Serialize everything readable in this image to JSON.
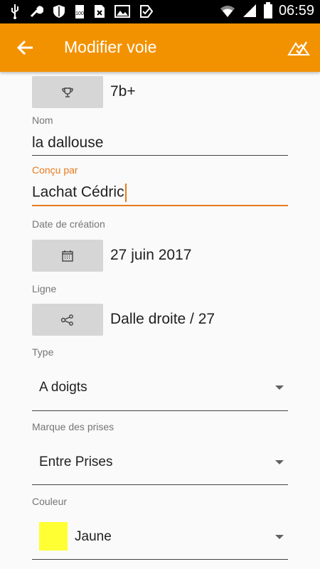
{
  "status_bar": {
    "time": "06:59",
    "icons": [
      "usb-icon",
      "wrench-icon",
      "shield-icon",
      "battery-full-icon",
      "sim-icon",
      "image-icon",
      "checkmark-icon",
      "wifi-icon",
      "signal-icon",
      "battery-icon"
    ]
  },
  "app_bar": {
    "title": "Modifier voie",
    "back_icon": "arrow-back-icon",
    "action_icon": "mountain-check-icon",
    "color": "#f39200"
  },
  "form": {
    "grade": {
      "icon": "trophy-icon",
      "value": "7b+"
    },
    "name": {
      "label": "Nom",
      "value": "la dallouse"
    },
    "designer": {
      "label": "Conçu par",
      "value": "Lachat Cédric",
      "focused": true
    },
    "creation_date": {
      "label": "Date de création",
      "icon": "calendar-icon",
      "value": "27 juin 2017"
    },
    "line": {
      "label": "Ligne",
      "icon": "share-icon",
      "value": "Dalle droite / 27"
    },
    "type": {
      "label": "Type",
      "selected": "A doigts"
    },
    "holds_brand": {
      "label": "Marque des prises",
      "selected": "Entre Prises"
    },
    "color": {
      "label": "Couleur",
      "selected": "Jaune",
      "swatch": "#ffff33"
    }
  },
  "accent_color": "#e87a1c"
}
